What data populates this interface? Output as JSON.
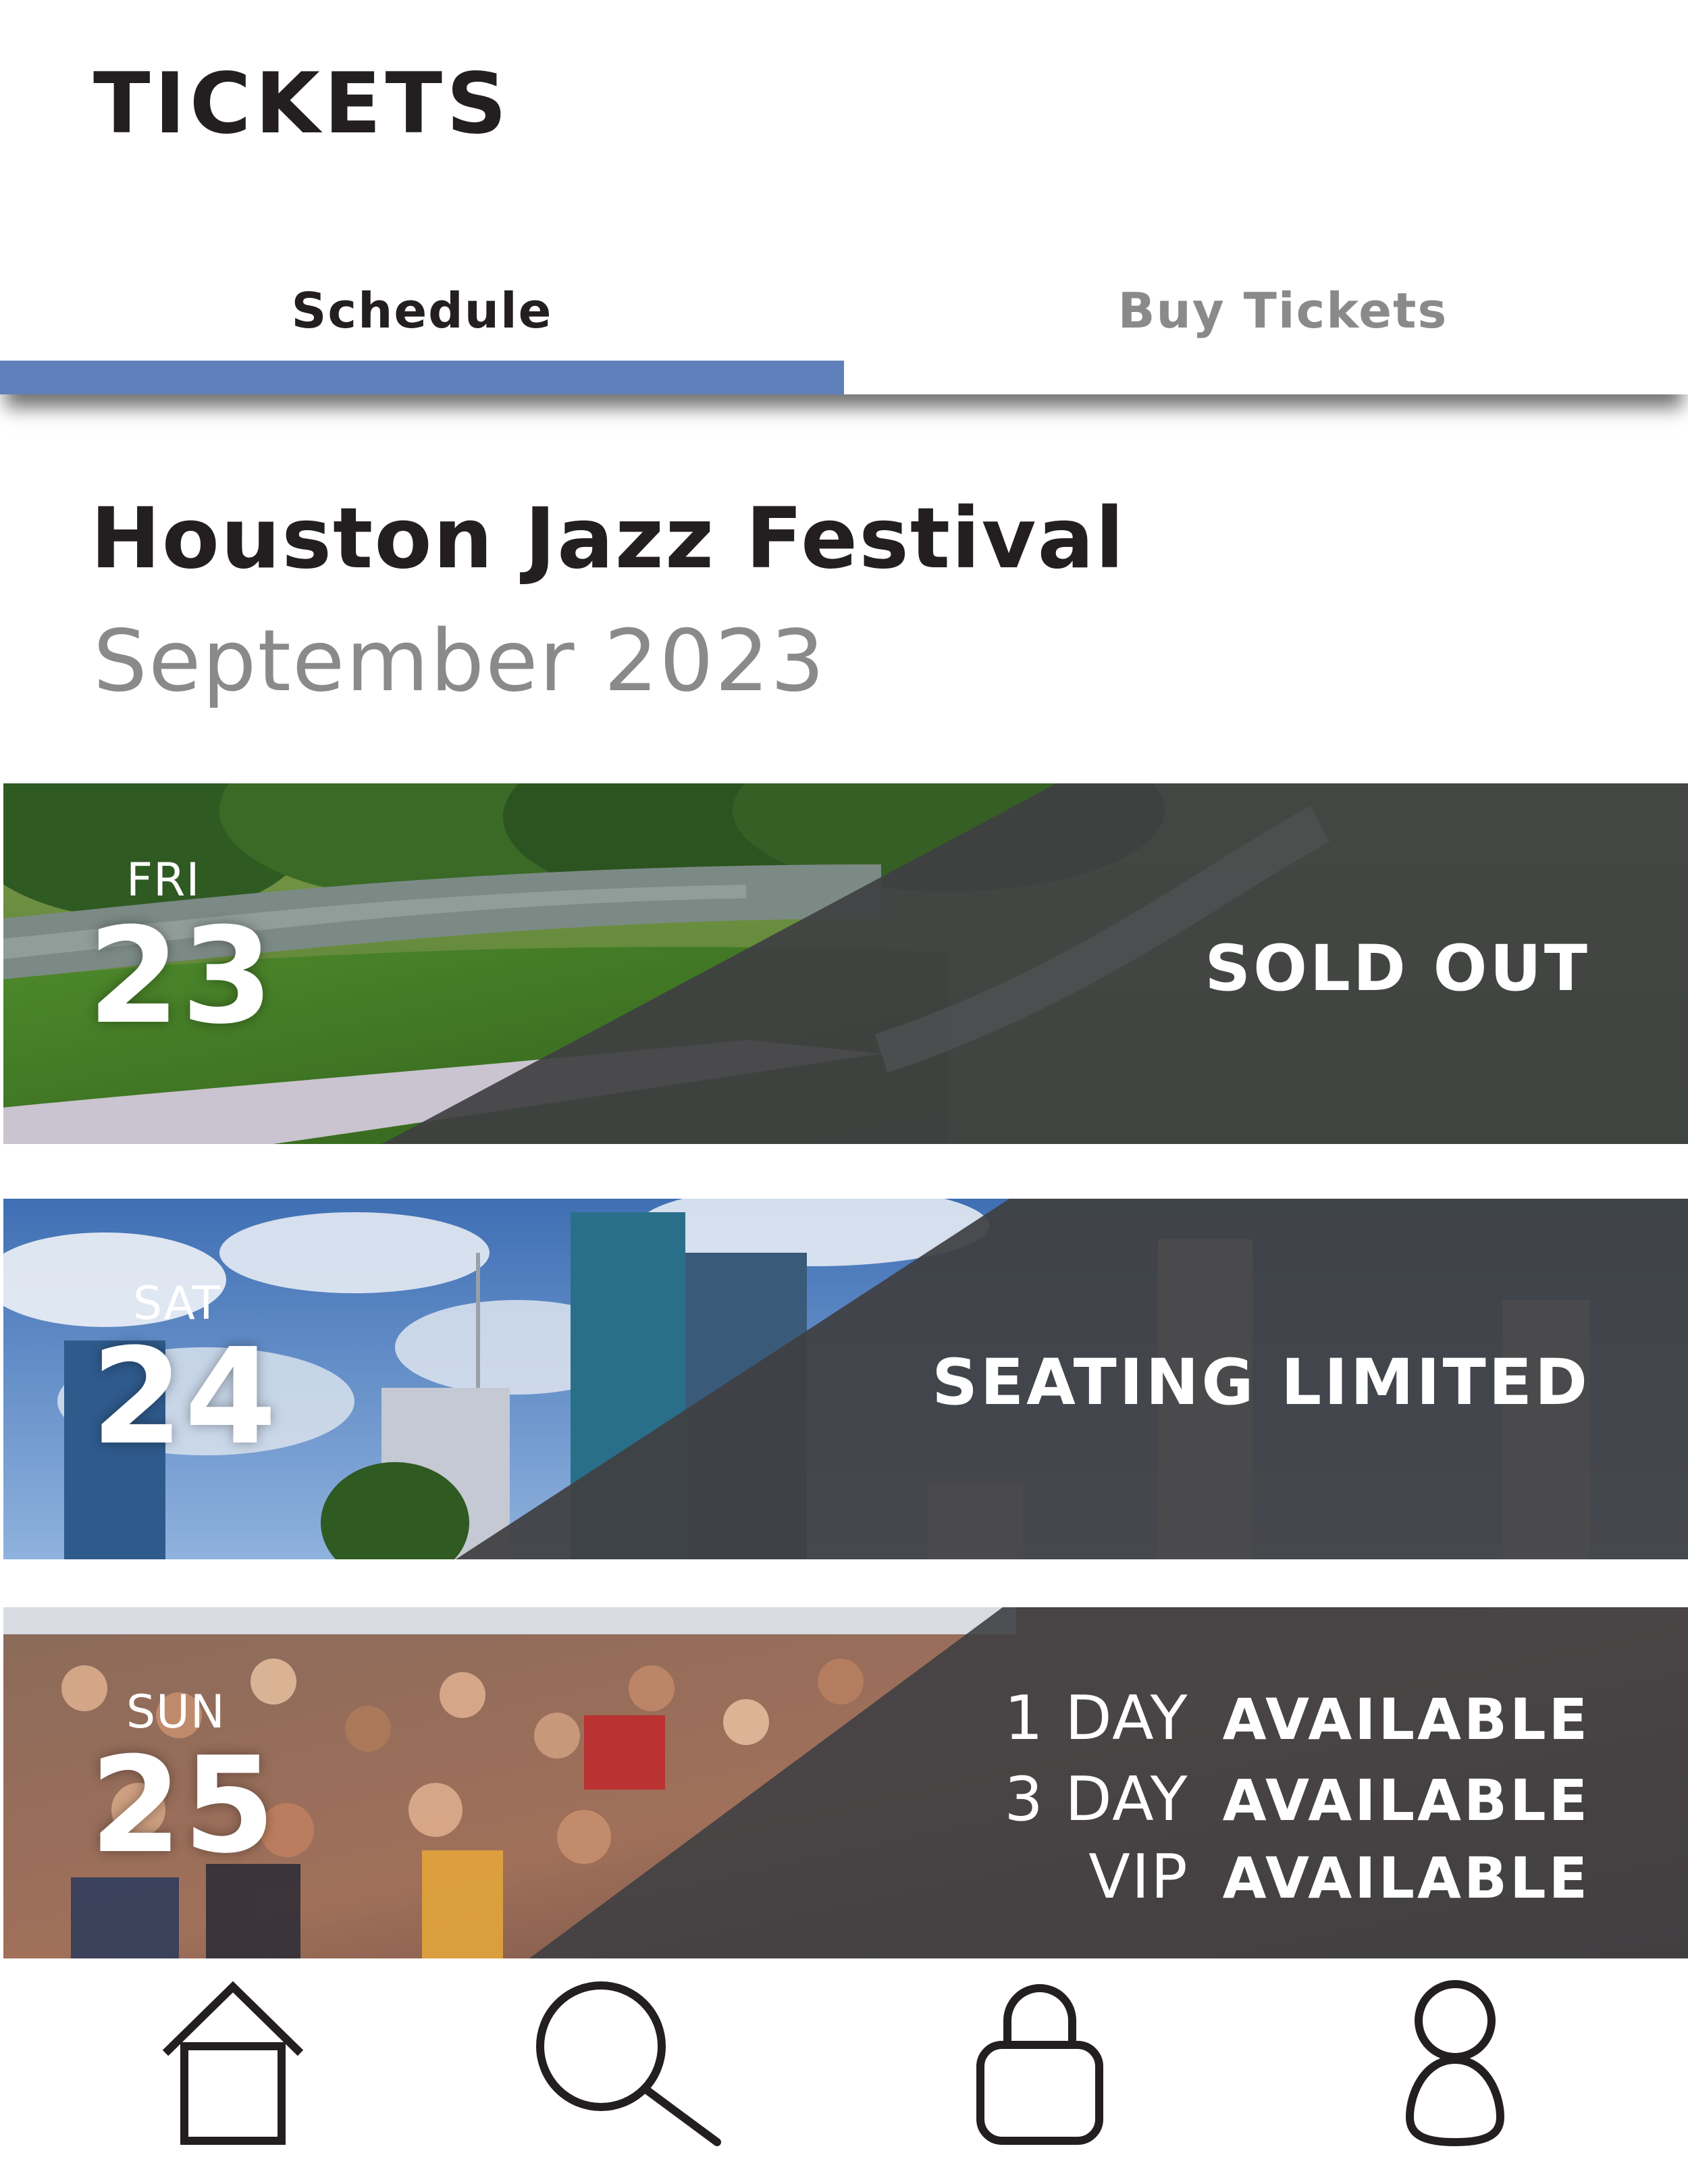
{
  "header": {
    "title": "TICKETS",
    "tabs": [
      {
        "label": "Schedule",
        "active": true
      },
      {
        "label": "Buy Tickets",
        "active": false
      }
    ],
    "accent_color": "#6080bb"
  },
  "festival": {
    "title": "Houston Jazz Festival",
    "subtitle": "September 2023"
  },
  "days": [
    {
      "dow": "FRI",
      "day": "23",
      "status": "SOLD OUT"
    },
    {
      "dow": "SAT",
      "day": "24",
      "status": "SEATING LIMITED"
    },
    {
      "dow": "SUN",
      "day": "25",
      "options": [
        {
          "label": "1 DAY",
          "value": "AVAILABLE"
        },
        {
          "label": "3 DAY",
          "value": "AVAILABLE"
        },
        {
          "label": "VIP",
          "value": "AVAILABLE"
        }
      ]
    }
  ],
  "nav": {
    "icons": [
      "home-icon",
      "search-icon",
      "lock-icon",
      "profile-icon"
    ]
  }
}
